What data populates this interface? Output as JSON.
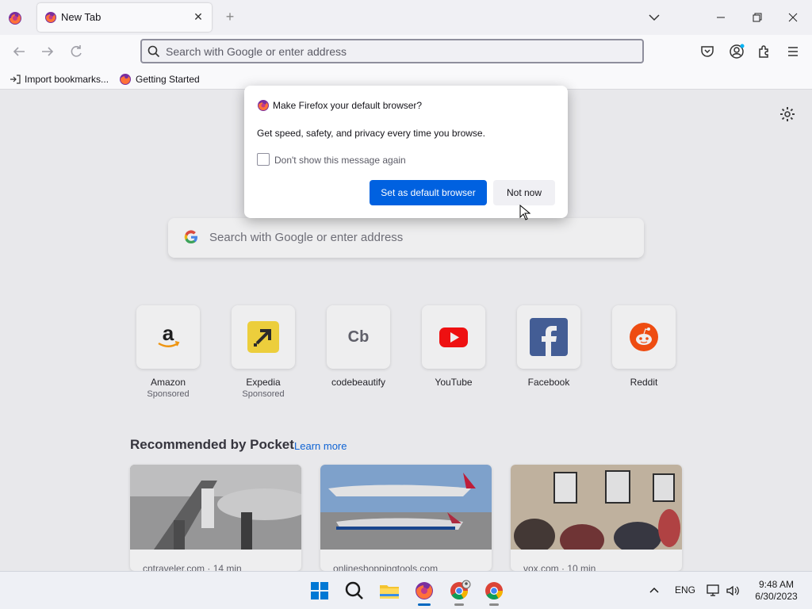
{
  "browser": {
    "tab": {
      "title": "New Tab"
    },
    "new_tab_symbol": "+",
    "close_symbol": "✕",
    "urlbar": {
      "placeholder": "Search with Google or enter address"
    },
    "bookmarks": [
      {
        "label": "Import bookmarks...",
        "icon": "import-icon"
      },
      {
        "label": "Getting Started",
        "icon": "firefox-icon"
      }
    ]
  },
  "newtab": {
    "search": {
      "placeholder": "Search with Google or enter address"
    },
    "top_sites": [
      {
        "label": "Amazon",
        "sponsored": "Sponsored",
        "icon": "amazon-icon"
      },
      {
        "label": "Expedia",
        "sponsored": "Sponsored",
        "icon": "expedia-icon"
      },
      {
        "label": "codebeautify",
        "sponsored": "",
        "icon": "codebeautify-icon",
        "abbr": "Cb"
      },
      {
        "label": "YouTube",
        "sponsored": "",
        "icon": "youtube-icon"
      },
      {
        "label": "Facebook",
        "sponsored": "",
        "icon": "facebook-icon"
      },
      {
        "label": "Reddit",
        "sponsored": "",
        "icon": "reddit-icon"
      }
    ],
    "pocket": {
      "heading": "Recommended by Pocket",
      "learn_more": "Learn more",
      "cards": [
        {
          "source": "cntraveler.com · 14 min"
        },
        {
          "source": "onlineshoppingtools.com"
        },
        {
          "source": "vox.com · 10 min"
        }
      ]
    }
  },
  "dialog": {
    "title": "Make Firefox your default browser?",
    "body": "Get speed, safety, and privacy every time you browse.",
    "checkbox_label": "Don't show this message again",
    "checkbox_checked": false,
    "primary_button": "Set as default browser",
    "secondary_button": "Not now"
  },
  "taskbar": {
    "apps": [
      "start-icon",
      "search-icon",
      "file-explorer-icon",
      "firefox-icon",
      "chrome-profile-icon",
      "chrome-icon"
    ],
    "language": "ENG",
    "time": "9:48 AM",
    "date": "6/30/2023"
  },
  "colors": {
    "accent": "#0061e0",
    "windows_accent": "#0067c0"
  }
}
